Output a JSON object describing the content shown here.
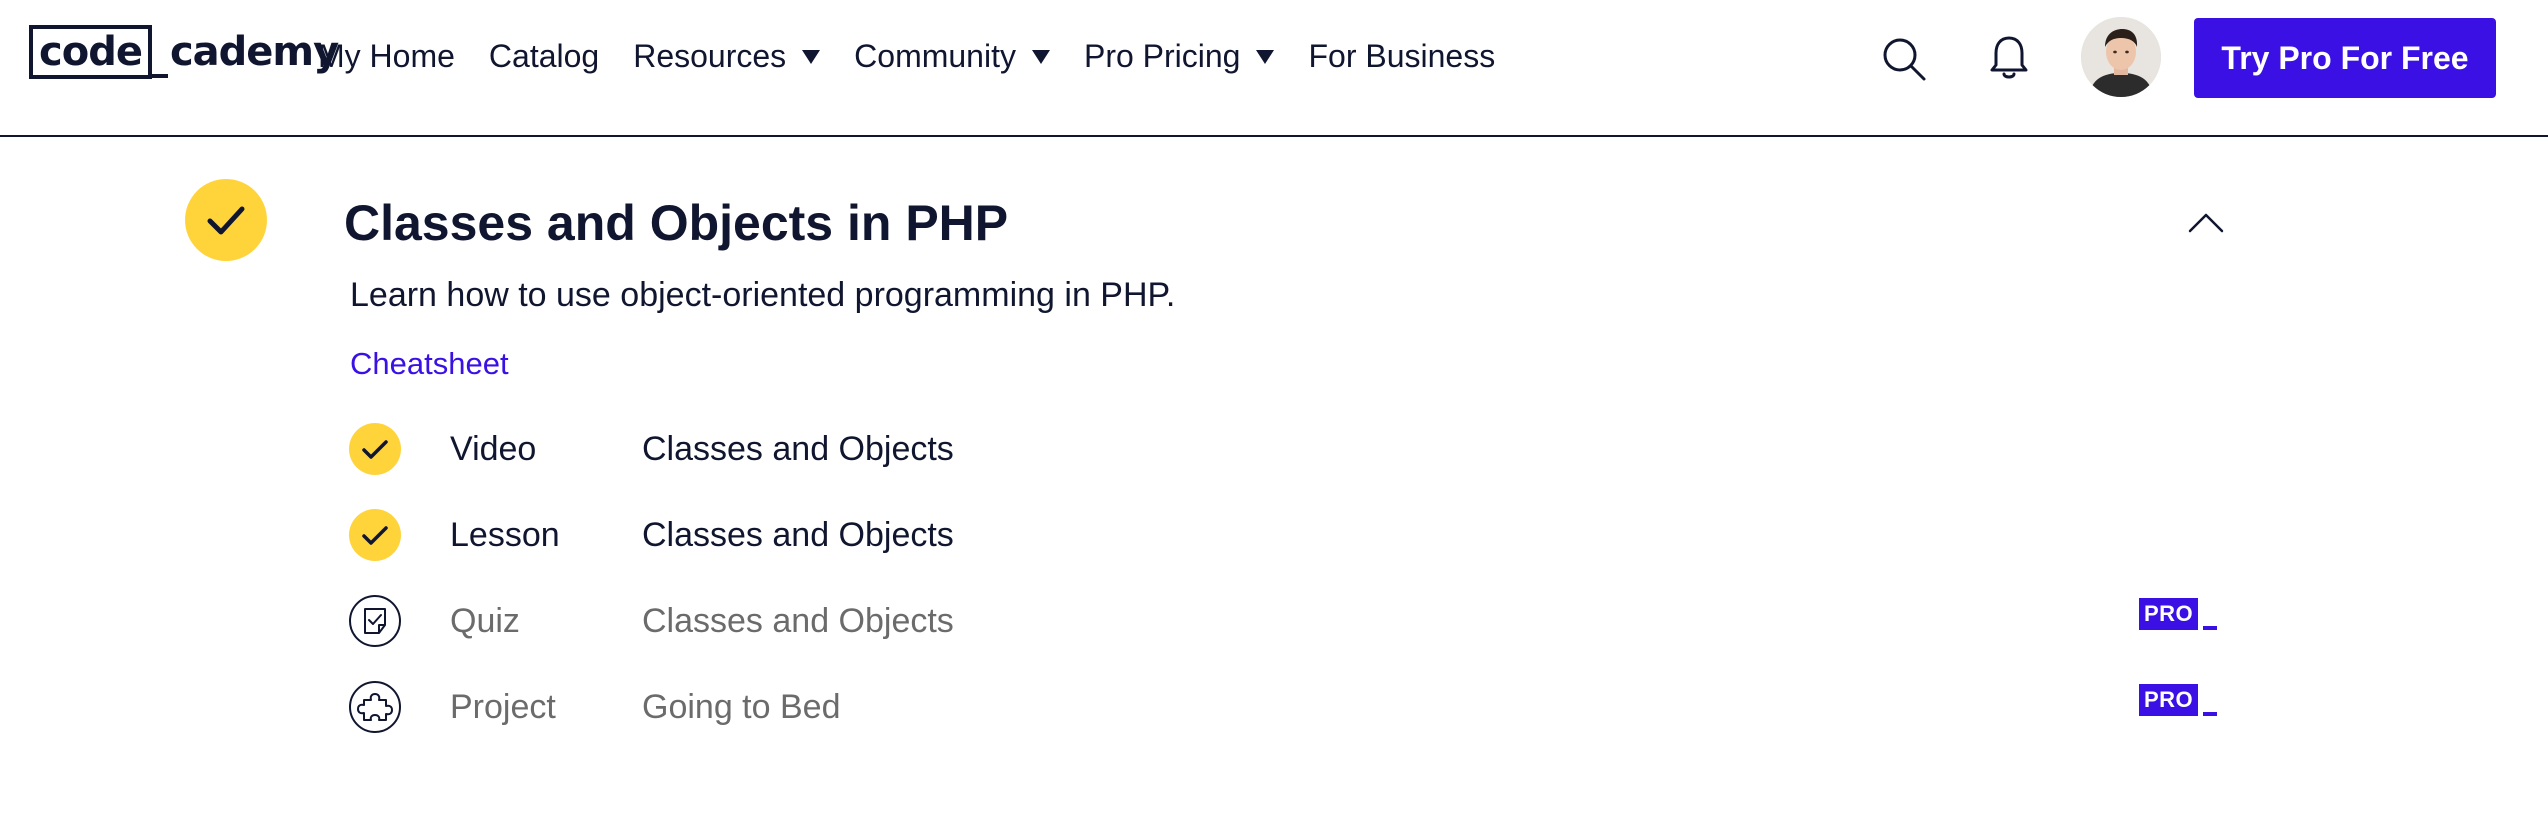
{
  "header": {
    "logo": {
      "boxed_text": "code",
      "rest_text": "cademy"
    },
    "nav": [
      {
        "label": "My Home",
        "has_dropdown": false
      },
      {
        "label": "Catalog",
        "has_dropdown": false
      },
      {
        "label": "Resources",
        "has_dropdown": true
      },
      {
        "label": "Community",
        "has_dropdown": true
      },
      {
        "label": "Pro Pricing",
        "has_dropdown": true
      },
      {
        "label": "For Business",
        "has_dropdown": false
      }
    ],
    "icons": {
      "search": "search-icon",
      "notifications": "bell-icon",
      "avatar": "user-avatar"
    },
    "cta_label": "Try Pro For Free"
  },
  "module": {
    "title": "Classes and Objects in PHP",
    "completed": true,
    "expanded": true,
    "description": "Learn how to use object-oriented programming in PHP.",
    "cheatsheet_label": "Cheatsheet",
    "items": [
      {
        "type": "Video",
        "title": "Classes and Objects",
        "completed": true,
        "icon": "check-icon",
        "pro": false
      },
      {
        "type": "Lesson",
        "title": "Classes and Objects",
        "completed": true,
        "icon": "check-icon",
        "pro": false
      },
      {
        "type": "Quiz",
        "title": "Classes and Objects",
        "completed": false,
        "icon": "quiz-icon",
        "pro": true
      },
      {
        "type": "Project",
        "title": "Going to Bed",
        "completed": false,
        "icon": "puzzle-icon",
        "pro": true
      }
    ],
    "pro_badge_label": "PRO"
  },
  "colors": {
    "brand": "#3a10e5",
    "check_yellow": "#ffd43b",
    "text_dark": "#10162f",
    "text_muted": "#6b6b6b"
  }
}
